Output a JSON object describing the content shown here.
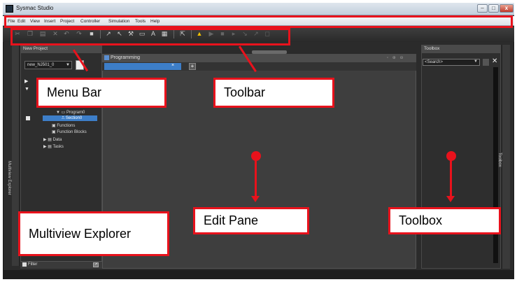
{
  "window": {
    "title": "Sysmac Studio"
  },
  "window_controls": [
    "–",
    "□",
    "x"
  ],
  "menu": [
    "File",
    "Edit",
    "View",
    "Insert",
    "Project",
    "Controller",
    "Simulation",
    "Tools",
    "Help"
  ],
  "multiview": {
    "strip_label": "Multiview Explorer",
    "title": "New Project",
    "device": "new_NJ501_0",
    "tree": [
      "Program0",
      "Section0",
      "Functions",
      "Function Blocks",
      "Data",
      "Tasks"
    ],
    "filter_label": "Filter"
  },
  "edit_pane": {
    "title": "Programming"
  },
  "toolbox": {
    "title": "Toolbox",
    "search_placeholder": "<Search>",
    "strip_label": "Toolbox"
  },
  "annotations": {
    "menu_bar": "Menu Bar",
    "toolbar": "Toolbar",
    "multiview": "Multiview Explorer",
    "edit_pane": "Edit Pane",
    "toolbox": "Toolbox"
  },
  "colors": {
    "annotation": "#e8121c",
    "selection": "#3d7ec8",
    "warning": "#f2c100"
  },
  "icons": [
    "app-icon",
    "undo-icon",
    "redo-icon",
    "cut-icon",
    "copy-icon",
    "paste-icon",
    "delete-icon",
    "build-icon",
    "find-icon",
    "warning-icon",
    "plus-icon",
    "close-icon",
    "dropdown-icon"
  ]
}
